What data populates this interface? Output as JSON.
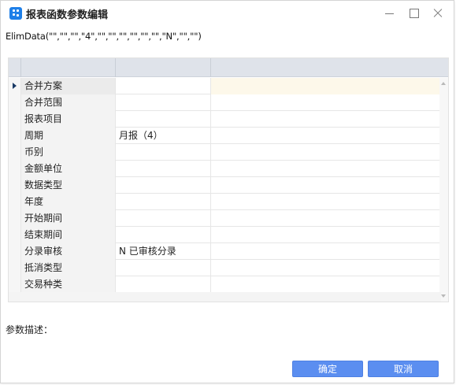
{
  "window": {
    "title": "报表函数参数编辑",
    "icon": "app-grid-icon",
    "controls": [
      "minimize-icon",
      "maximize-icon",
      "close-icon"
    ]
  },
  "formula": "ElimData(\"\",\"\",\"\",\"4\",\"\",\"\",\"\",\"\",\"\",\"\",\"N\",\"\",\"\")",
  "grid": {
    "rows": [
      {
        "name": "合并方案",
        "value": ""
      },
      {
        "name": "合并范围",
        "value": ""
      },
      {
        "name": "报表项目",
        "value": ""
      },
      {
        "name": "周期",
        "value": "月报（4）"
      },
      {
        "name": "币别",
        "value": ""
      },
      {
        "name": "金额单位",
        "value": ""
      },
      {
        "name": "数据类型",
        "value": ""
      },
      {
        "name": "年度",
        "value": ""
      },
      {
        "name": "开始期间",
        "value": ""
      },
      {
        "name": "结束期间",
        "value": ""
      },
      {
        "name": "分录审核",
        "value": "N  已审核分录"
      },
      {
        "name": "抵消类型",
        "value": ""
      },
      {
        "name": "交易种类",
        "value": ""
      }
    ],
    "active_row_index": 0
  },
  "description": {
    "label": "参数描述："
  },
  "buttons": {
    "ok": "确定",
    "cancel": "取消"
  },
  "colors": {
    "accent": "#5b8ef0",
    "header_bg": "#dfe3ea",
    "active_row": "#fdf8ea",
    "icon": "#1e7fe8"
  }
}
